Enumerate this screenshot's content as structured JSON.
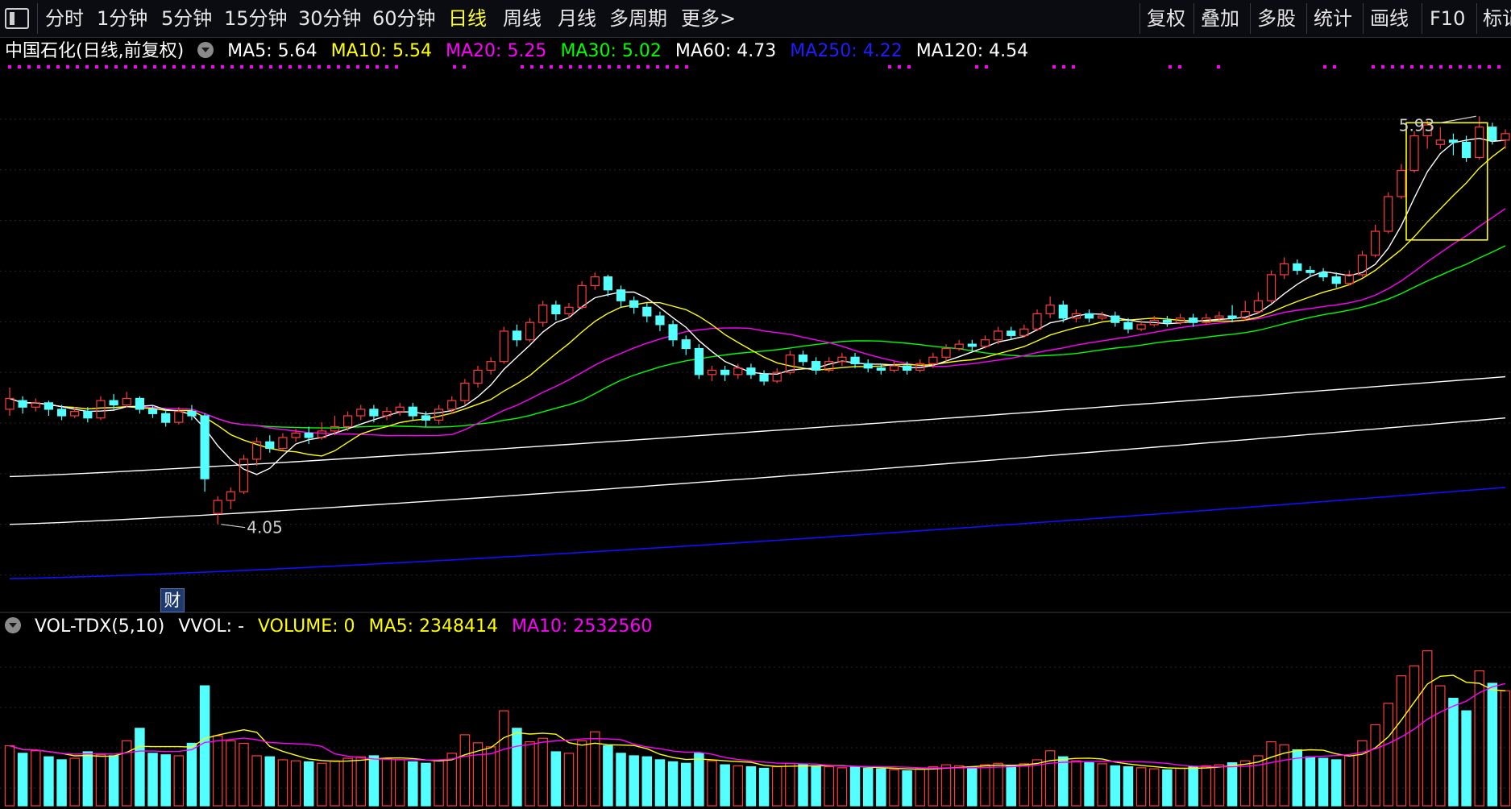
{
  "toolbar": {
    "left_items": [
      {
        "label": "分时",
        "active": false
      },
      {
        "label": "1分钟",
        "active": false
      },
      {
        "label": "5分钟",
        "active": false
      },
      {
        "label": "15分钟",
        "active": false
      },
      {
        "label": "30分钟",
        "active": false
      },
      {
        "label": "60分钟",
        "active": false
      },
      {
        "label": "日线",
        "active": true
      },
      {
        "label": "周线",
        "active": false
      },
      {
        "label": "月线",
        "active": false
      },
      {
        "label": "多周期",
        "active": false
      },
      {
        "label": "更多>",
        "active": false
      }
    ],
    "right_items": [
      "复权",
      "叠加",
      "多股",
      "统计",
      "画线",
      "F10",
      "标记"
    ]
  },
  "info": {
    "title": "中国石化(日线,前复权)",
    "ma5": "MA5: 5.64",
    "ma10": "MA10: 5.54",
    "ma20": "MA20: 5.25",
    "ma30": "MA30: 5.02",
    "ma60": "MA60: 4.73",
    "ma250": "MA250: 4.22",
    "ma120": "MA120: 4.54"
  },
  "volume_info": {
    "title": "VOL-TDX(5,10)",
    "vvol": "VVOL: -",
    "volume": "VOLUME: 0",
    "ma5": "MA5: 2348414",
    "ma10": "MA10: 2532560"
  },
  "badge": "财",
  "colors": {
    "up": "#ff3b3b",
    "down": "#54ffff",
    "ma5": "#ffffff",
    "ma10": "#ffff00",
    "ma20": "#ff00ff",
    "ma30": "#00ff00",
    "ma60": "#ffffff",
    "ma120": "#ffffff",
    "ma250": "#1010ff",
    "highlight_box": "#ffff00",
    "marker_dots": "#ff00ff"
  },
  "chart_data": {
    "type": "candlestick",
    "title": "中国石化(日线,前复权)",
    "price_range": [
      3.7,
      6.15
    ],
    "annotations": [
      {
        "label": "5.93",
        "value": 5.93,
        "type": "max"
      },
      {
        "label": "4.05",
        "value": 4.05,
        "type": "min"
      }
    ],
    "candles": [
      [
        4.58,
        4.63,
        4.68,
        4.55
      ],
      [
        4.62,
        4.59,
        4.64,
        4.56
      ],
      [
        4.59,
        4.61,
        4.63,
        4.57
      ],
      [
        4.61,
        4.58,
        4.62,
        4.55
      ],
      [
        4.58,
        4.55,
        4.6,
        4.53
      ],
      [
        4.55,
        4.57,
        4.59,
        4.54
      ],
      [
        4.57,
        4.54,
        4.59,
        4.52
      ],
      [
        4.54,
        4.62,
        4.64,
        4.53
      ],
      [
        4.62,
        4.6,
        4.65,
        4.58
      ],
      [
        4.6,
        4.63,
        4.66,
        4.59
      ],
      [
        4.63,
        4.58,
        4.64,
        4.56
      ],
      [
        4.58,
        4.56,
        4.6,
        4.54
      ],
      [
        4.56,
        4.52,
        4.58,
        4.5
      ],
      [
        4.52,
        4.57,
        4.59,
        4.51
      ],
      [
        4.57,
        4.55,
        4.6,
        4.53
      ],
      [
        4.55,
        4.26,
        4.56,
        4.2
      ],
      [
        4.1,
        4.16,
        4.18,
        4.05
      ],
      [
        4.16,
        4.2,
        4.22,
        4.12
      ],
      [
        4.2,
        4.35,
        4.37,
        4.19
      ],
      [
        4.35,
        4.43,
        4.45,
        4.32
      ],
      [
        4.43,
        4.4,
        4.46,
        4.38
      ],
      [
        4.4,
        4.45,
        4.47,
        4.39
      ],
      [
        4.45,
        4.47,
        4.49,
        4.43
      ],
      [
        4.47,
        4.45,
        4.5,
        4.42
      ],
      [
        4.45,
        4.48,
        4.52,
        4.44
      ],
      [
        4.48,
        4.5,
        4.55,
        4.46
      ],
      [
        4.5,
        4.55,
        4.57,
        4.48
      ],
      [
        4.55,
        4.58,
        4.6,
        4.53
      ],
      [
        4.58,
        4.55,
        4.6,
        4.52
      ],
      [
        4.55,
        4.57,
        4.59,
        4.53
      ],
      [
        4.57,
        4.59,
        4.61,
        4.55
      ],
      [
        4.59,
        4.55,
        4.61,
        4.53
      ],
      [
        4.55,
        4.53,
        4.57,
        4.5
      ],
      [
        4.53,
        4.58,
        4.6,
        4.51
      ],
      [
        4.58,
        4.62,
        4.64,
        4.56
      ],
      [
        4.62,
        4.7,
        4.72,
        4.6
      ],
      [
        4.7,
        4.76,
        4.78,
        4.68
      ],
      [
        4.76,
        4.8,
        4.82,
        4.74
      ],
      [
        4.8,
        4.94,
        4.96,
        4.79
      ],
      [
        4.94,
        4.9,
        4.97,
        4.87
      ],
      [
        4.9,
        4.98,
        5.0,
        4.89
      ],
      [
        4.98,
        5.06,
        5.08,
        4.96
      ],
      [
        5.06,
        5.02,
        5.08,
        4.99
      ],
      [
        5.02,
        5.05,
        5.07,
        5.0
      ],
      [
        5.05,
        5.15,
        5.17,
        5.04
      ],
      [
        5.15,
        5.19,
        5.21,
        5.13
      ],
      [
        5.19,
        5.13,
        5.2,
        5.1
      ],
      [
        5.13,
        5.08,
        5.15,
        5.05
      ],
      [
        5.08,
        5.05,
        5.1,
        5.02
      ],
      [
        5.05,
        5.01,
        5.07,
        4.98
      ],
      [
        5.01,
        4.97,
        5.03,
        4.94
      ],
      [
        4.97,
        4.9,
        4.99,
        4.87
      ],
      [
        4.9,
        4.86,
        4.92,
        4.83
      ],
      [
        4.86,
        4.74,
        4.88,
        4.72
      ],
      [
        4.74,
        4.76,
        4.78,
        4.71
      ],
      [
        4.76,
        4.74,
        4.78,
        4.71
      ],
      [
        4.74,
        4.77,
        4.79,
        4.72
      ],
      [
        4.77,
        4.74,
        4.79,
        4.72
      ],
      [
        4.74,
        4.71,
        4.76,
        4.69
      ],
      [
        4.71,
        4.75,
        4.77,
        4.7
      ],
      [
        4.75,
        4.83,
        4.85,
        4.74
      ],
      [
        4.83,
        4.8,
        4.85,
        4.78
      ],
      [
        4.8,
        4.76,
        4.82,
        4.74
      ],
      [
        4.76,
        4.8,
        4.82,
        4.75
      ],
      [
        4.8,
        4.82,
        4.84,
        4.78
      ],
      [
        4.82,
        4.79,
        4.84,
        4.77
      ],
      [
        4.79,
        4.77,
        4.81,
        4.75
      ],
      [
        4.77,
        4.76,
        4.79,
        4.74
      ],
      [
        4.76,
        4.78,
        4.8,
        4.75
      ],
      [
        4.78,
        4.76,
        4.8,
        4.74
      ],
      [
        4.76,
        4.79,
        4.81,
        4.75
      ],
      [
        4.79,
        4.82,
        4.84,
        4.77
      ],
      [
        4.82,
        4.86,
        4.88,
        4.8
      ],
      [
        4.86,
        4.88,
        4.9,
        4.85
      ],
      [
        4.88,
        4.87,
        4.9,
        4.85
      ],
      [
        4.87,
        4.9,
        4.92,
        4.86
      ],
      [
        4.9,
        4.94,
        4.96,
        4.88
      ],
      [
        4.94,
        4.92,
        4.96,
        4.9
      ],
      [
        4.92,
        4.95,
        4.97,
        4.91
      ],
      [
        4.95,
        5.02,
        5.04,
        4.94
      ],
      [
        5.02,
        5.06,
        5.1,
        5.0
      ],
      [
        5.06,
        5.0,
        5.08,
        4.98
      ],
      [
        5.0,
        5.02,
        5.04,
        4.98
      ],
      [
        5.02,
        5.0,
        5.04,
        4.98
      ],
      [
        5.0,
        5.01,
        5.03,
        4.99
      ],
      [
        5.01,
        4.98,
        5.03,
        4.96
      ],
      [
        4.98,
        4.95,
        5.0,
        4.93
      ],
      [
        4.95,
        4.97,
        4.99,
        4.94
      ],
      [
        4.97,
        4.99,
        5.01,
        4.96
      ],
      [
        4.99,
        4.98,
        5.01,
        4.96
      ],
      [
        4.98,
        5.0,
        5.02,
        4.97
      ],
      [
        5.0,
        4.98,
        5.02,
        4.96
      ],
      [
        4.98,
        5.0,
        5.02,
        4.97
      ],
      [
        5.0,
        5.01,
        5.03,
        4.99
      ],
      [
        5.01,
        5.0,
        5.06,
        4.98
      ],
      [
        5.0,
        5.03,
        5.08,
        4.99
      ],
      [
        5.03,
        5.08,
        5.12,
        5.02
      ],
      [
        5.08,
        5.2,
        5.22,
        5.07
      ],
      [
        5.2,
        5.25,
        5.28,
        5.18
      ],
      [
        5.25,
        5.22,
        5.27,
        5.2
      ],
      [
        5.22,
        5.21,
        5.24,
        5.19
      ],
      [
        5.21,
        5.19,
        5.23,
        5.17
      ],
      [
        5.19,
        5.16,
        5.21,
        5.14
      ],
      [
        5.16,
        5.2,
        5.22,
        5.15
      ],
      [
        5.2,
        5.29,
        5.31,
        5.19
      ],
      [
        5.29,
        5.4,
        5.43,
        5.28
      ],
      [
        5.4,
        5.56,
        5.58,
        5.39
      ],
      [
        5.56,
        5.68,
        5.71,
        5.55
      ],
      [
        5.68,
        5.84,
        5.86,
        5.67
      ],
      [
        5.84,
        5.89,
        5.91,
        5.78
      ],
      [
        5.8,
        5.82,
        5.88,
        5.78
      ],
      [
        5.82,
        5.81,
        5.85,
        5.75
      ],
      [
        5.81,
        5.74,
        5.84,
        5.72
      ],
      [
        5.74,
        5.88,
        5.93,
        5.73
      ],
      [
        5.88,
        5.82,
        5.9,
        5.8
      ],
      [
        5.82,
        5.85,
        5.87,
        5.78
      ]
    ],
    "volumes": [
      1.2,
      1.05,
      1.1,
      0.98,
      0.92,
      0.95,
      1.08,
      1.02,
      1.0,
      1.3,
      1.55,
      1.05,
      1.02,
      1.0,
      1.25,
      2.4,
      1.4,
      1.3,
      1.25,
      1.0,
      0.98,
      0.92,
      0.9,
      0.88,
      0.85,
      0.9,
      0.95,
      0.98,
      1.0,
      0.94,
      0.92,
      0.88,
      0.85,
      0.9,
      1.05,
      1.42,
      1.26,
      1.18,
      1.9,
      1.55,
      1.28,
      1.35,
      1.08,
      1.05,
      1.3,
      1.48,
      1.2,
      1.05,
      1.0,
      0.98,
      0.92,
      0.88,
      0.85,
      1.05,
      0.9,
      0.82,
      0.8,
      0.78,
      0.75,
      0.78,
      0.85,
      0.82,
      0.8,
      0.78,
      0.76,
      0.78,
      0.75,
      0.74,
      0.72,
      0.7,
      0.74,
      0.78,
      0.82,
      0.8,
      0.78,
      0.82,
      0.85,
      0.8,
      0.84,
      0.92,
      1.1,
      0.98,
      0.9,
      0.86,
      0.84,
      0.8,
      0.78,
      0.76,
      0.74,
      0.72,
      0.75,
      0.78,
      0.8,
      0.82,
      0.86,
      0.9,
      1.0,
      1.28,
      1.22,
      1.12,
      0.98,
      0.95,
      0.92,
      1.0,
      1.3,
      1.62,
      2.05,
      2.6,
      2.8,
      3.1,
      2.4,
      2.15,
      1.9,
      2.7,
      2.45,
      2.3
    ]
  }
}
